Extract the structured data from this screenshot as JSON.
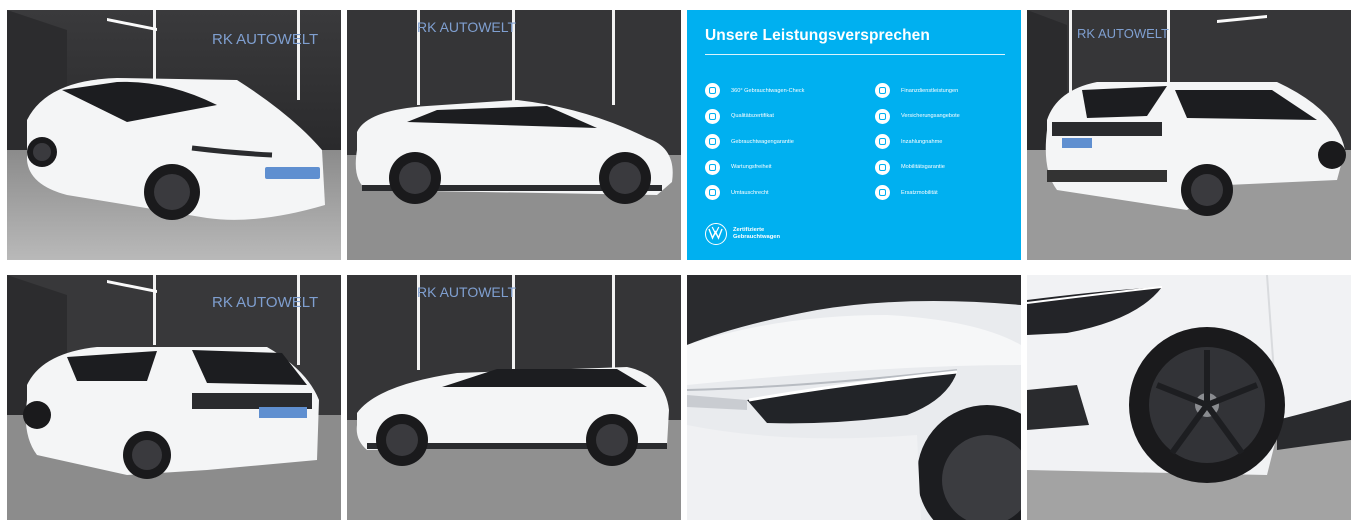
{
  "gallery": {
    "photos": [
      {
        "name": "photo-front-left",
        "alt": "front three-quarter view"
      },
      {
        "name": "photo-side-right",
        "alt": "right side view"
      },
      {
        "name": "photo-rear-right",
        "alt": "rear three-quarter view"
      },
      {
        "name": "photo-rear-left",
        "alt": "rear left view"
      },
      {
        "name": "photo-side-left",
        "alt": "left side view"
      },
      {
        "name": "photo-headlight-closeup",
        "alt": "headlight close-up"
      },
      {
        "name": "photo-wheel-closeup",
        "alt": "front wheel close-up"
      }
    ],
    "dealer_sign": "RK AUTOWELT",
    "plate_text": "RK AUTOWELT"
  },
  "promo": {
    "title": "Unsere Leistungsversprechen",
    "left_items": [
      "360° Gebrauchtwagen-Check",
      "Qualitätszertifikat",
      "Gebrauchtwagengarantie",
      "Wartungsfreiheit",
      "Umtauschrecht"
    ],
    "right_items": [
      "Finanzdienstleistungen",
      "Versicherungsangebote",
      "Inzahlungnahme",
      "Mobilitätsgarantie",
      "Ersatzmobilität"
    ],
    "footer_line1": "Zertifizierte",
    "footer_line2": "Gebrauchtwagen",
    "colors": {
      "background": "#00b0f0",
      "text": "#ffffff"
    }
  }
}
